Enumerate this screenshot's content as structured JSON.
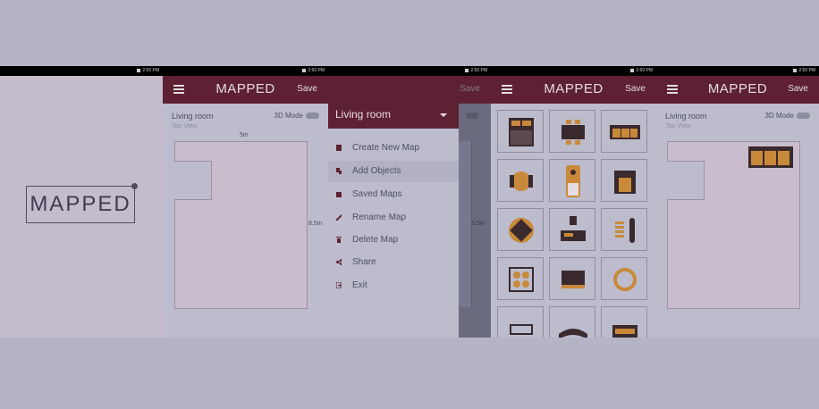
{
  "app": {
    "title": "MAPPED",
    "save_label": "Save"
  },
  "screen1": {
    "statusbar_time": "2:50 PM",
    "logo_text": "MAPPED"
  },
  "screen2": {
    "statusbar_time": "2:50 PM",
    "room_name": "Living room",
    "view_label": "Top View",
    "mode_label": "3D Mode",
    "width_dim": "5m",
    "height_dim": "8.5m"
  },
  "screen3": {
    "statusbar_time": "2:50 PM",
    "room_name": "Living room",
    "save_label": "Save",
    "side_dim": "8.5m",
    "menu": [
      {
        "label": "Create New Map",
        "icon": "new-map-icon"
      },
      {
        "label": "Add Objects",
        "icon": "add-objects-icon"
      },
      {
        "label": "Saved Maps",
        "icon": "saved-maps-icon"
      },
      {
        "label": "Rename Map",
        "icon": "pencil-icon"
      },
      {
        "label": "Delete Map",
        "icon": "trash-icon"
      },
      {
        "label": "Share",
        "icon": "share-icon"
      },
      {
        "label": "Exit",
        "icon": "exit-icon"
      }
    ]
  },
  "screen4": {
    "statusbar_time": "2:50 PM",
    "objects": [
      "bed-icon",
      "dining-table-icon",
      "sofa-icon",
      "chair-icon",
      "single-bed-icon",
      "armchair-icon",
      "round-table-icon",
      "desk-icon",
      "shelf-icon",
      "stove-icon",
      "tv-icon",
      "round-rug-icon",
      "bathtub-icon",
      "curved-sofa-icon",
      "couch-icon"
    ]
  },
  "screen5": {
    "statusbar_time": "2:50 PM",
    "room_name": "Living room",
    "view_label": "Top View",
    "mode_label": "3D Mode"
  },
  "colors": {
    "brand": "#5d2133",
    "background": "#b4b4c5",
    "panel": "#bcbccd",
    "accent_object": "#c9893a"
  }
}
